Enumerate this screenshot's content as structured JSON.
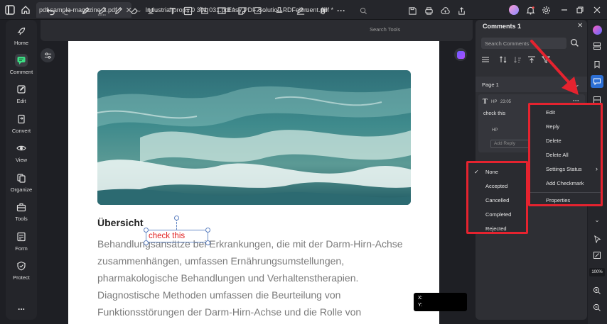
{
  "tabs": [
    {
      "label": "pdf-sample-magazine-3.pdf *",
      "active": true,
      "closable": true
    },
    {
      "label": "Industrial  prop...0 301 031.pdf *",
      "active": false,
      "closable": false
    },
    {
      "label": "Easy PDF Solutio...PDFelement.pdf *",
      "active": false,
      "closable": false
    }
  ],
  "sidebar": {
    "items": [
      {
        "label": "Home",
        "icon": "rocket-icon"
      },
      {
        "label": "Comment",
        "icon": "comment-icon",
        "active": true
      },
      {
        "label": "Edit",
        "icon": "edit-icon"
      },
      {
        "label": "Convert",
        "icon": "convert-icon"
      },
      {
        "label": "View",
        "icon": "eye-icon"
      },
      {
        "label": "Organize",
        "icon": "organize-icon"
      },
      {
        "label": "Tools",
        "icon": "toolbox-icon"
      },
      {
        "label": "Form",
        "icon": "form-icon"
      },
      {
        "label": "Protect",
        "icon": "shield-icon"
      }
    ],
    "more": "..."
  },
  "toolbar": {
    "search_placeholder": "Search Tools"
  },
  "document": {
    "heading": "Übersicht",
    "sticky_text": "check this",
    "lines": [
      "Behandlungsansätze bei Erkrankungen, die mit der Darm-Hirn-Achse",
      "zusammenhängen, umfassen Ernährungsumstellungen,",
      "pharmakologische Behandlungen und Verhaltenstherapien.",
      "Diagnostische Methoden umfassen die Beurteilung von",
      "Funktionsstörungen der Darm-Hirn-Achse und die Rolle von"
    ],
    "coord_x": "X:",
    "coord_y": "Y:"
  },
  "comments_panel": {
    "title": "Comments 1",
    "search_placeholder": "Search Comments",
    "page_label": "Page 1",
    "comment": {
      "author": "HP",
      "time": "23:05",
      "text": "check this",
      "reply_author": "HP",
      "reply_placeholder": "Add Reply",
      "more": "···"
    }
  },
  "context_menu": {
    "items": [
      "Edit",
      "Reply",
      "Delete",
      "Delete All",
      "Settings Status",
      "Add Checkmark",
      "Properties"
    ],
    "submenu_arrow": "›"
  },
  "status_menu": {
    "items": [
      "None",
      "Accepted",
      "Cancelled",
      "Completed",
      "Rejected"
    ],
    "checked": "None",
    "check": "✓"
  },
  "zoom": {
    "value": "100%"
  },
  "colors": {
    "accent": "#3b82f6",
    "highlight": "#e5232f",
    "sticky_text": "#e01f1f"
  }
}
